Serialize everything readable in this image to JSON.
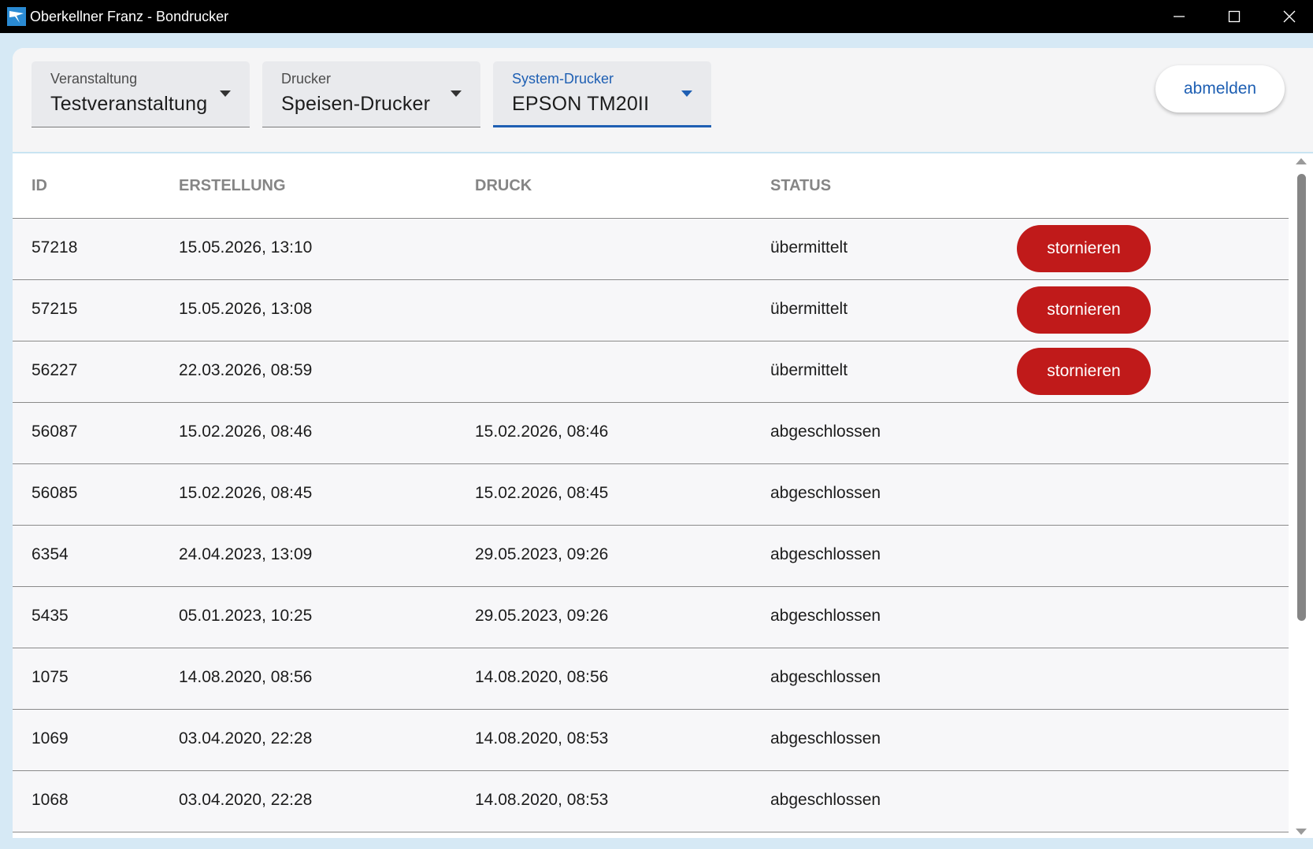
{
  "window": {
    "title": "Oberkellner Franz - Bondrucker",
    "minimize_icon": "minimize-icon",
    "maximize_icon": "maximize-icon",
    "close_icon": "close-icon"
  },
  "toolbar": {
    "selects": [
      {
        "label": "Veranstaltung",
        "value": "Testveranstaltung"
      },
      {
        "label": "Drucker",
        "value": "Speisen-Drucker"
      },
      {
        "label": "System-Drucker",
        "value": "EPSON TM20II"
      }
    ],
    "logout_label": "abmelden"
  },
  "table": {
    "headers": {
      "id": "ID",
      "erstellung": "ERSTELLUNG",
      "druck": "DRUCK",
      "status": "STATUS"
    },
    "cancel_label": "stornieren",
    "rows": [
      {
        "id": "57218",
        "erstellung": "15.05.2026, 13:10",
        "druck": "",
        "status": "übermittelt",
        "cancel": "stornieren"
      },
      {
        "id": "57215",
        "erstellung": "15.05.2026, 13:08",
        "druck": "",
        "status": "übermittelt",
        "cancel": "stornieren"
      },
      {
        "id": "56227",
        "erstellung": "22.03.2026, 08:59",
        "druck": "",
        "status": "übermittelt",
        "cancel": "stornieren"
      },
      {
        "id": "56087",
        "erstellung": "15.02.2026, 08:46",
        "druck": "15.02.2026, 08:46",
        "status": "abgeschlossen"
      },
      {
        "id": "56085",
        "erstellung": "15.02.2026, 08:45",
        "druck": "15.02.2026, 08:45",
        "status": "abgeschlossen"
      },
      {
        "id": "6354",
        "erstellung": "24.04.2023, 13:09",
        "druck": "29.05.2023, 09:26",
        "status": "abgeschlossen"
      },
      {
        "id": "5435",
        "erstellung": "05.01.2023, 10:25",
        "druck": "29.05.2023, 09:26",
        "status": "abgeschlossen"
      },
      {
        "id": "1075",
        "erstellung": "14.08.2020, 08:56",
        "druck": "14.08.2020, 08:56",
        "status": "abgeschlossen"
      },
      {
        "id": "1069",
        "erstellung": "03.04.2020, 22:28",
        "druck": "14.08.2020, 08:53",
        "status": "abgeschlossen"
      },
      {
        "id": "1068",
        "erstellung": "03.04.2020, 22:28",
        "druck": "14.08.2020, 08:53",
        "status": "abgeschlossen"
      }
    ]
  },
  "colors": {
    "accent": "#1e5fb3",
    "cancel_button": "#c01a1a",
    "background": "#d6e9f5"
  }
}
